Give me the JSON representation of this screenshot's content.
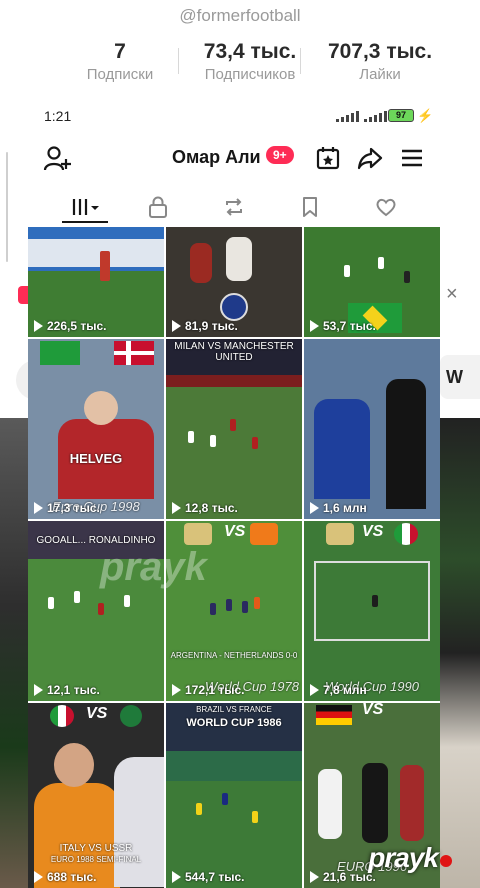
{
  "profile": {
    "handle": "@formerfootball",
    "stats": [
      {
        "value": "7",
        "label": "Подписки"
      },
      {
        "value": "73,4 тыс.",
        "label": "Подписчиков"
      },
      {
        "value": "707,3 тыс.",
        "label": "Лайки"
      }
    ]
  },
  "status_bar": {
    "time": "1:21",
    "battery": "97"
  },
  "header": {
    "name": "Омар Али",
    "notif_badge": "9+"
  },
  "side": {
    "right_card_text": "W"
  },
  "videos": [
    {
      "views": "226,5 тыс."
    },
    {
      "views": "81,9 тыс."
    },
    {
      "views": "53,7 тыс."
    },
    {
      "views": "17,3 тыс.",
      "caption": "Euro Cup 1998",
      "overlay": "HELVEG"
    },
    {
      "views": "12,8 тыс.",
      "caption": "MILAN VS MANCHESTER UNITED"
    },
    {
      "views": "1,6 млн"
    },
    {
      "views": "12,1 тыс.",
      "caption": "GOOALL... RONALDINHO"
    },
    {
      "views": "172,1 тыс.",
      "caption": "World Cup 1978",
      "overlay": "ARGENTINA - NETHERLANDS 0-0"
    },
    {
      "views": "7,8 млн",
      "caption": "World Cup 1990"
    },
    {
      "views": "688 тыс.",
      "caption": "ITALY VS USSR",
      "overlay": "EURO 1988 SEMI-FINAL"
    },
    {
      "views": "544,7 тыс.",
      "caption": "WORLD CUP 1986",
      "overlay": "BRAZIL VS FRANCE"
    },
    {
      "views": "21,6 тыс.",
      "caption": "EURO 1996"
    }
  ],
  "watermark": "prayk"
}
